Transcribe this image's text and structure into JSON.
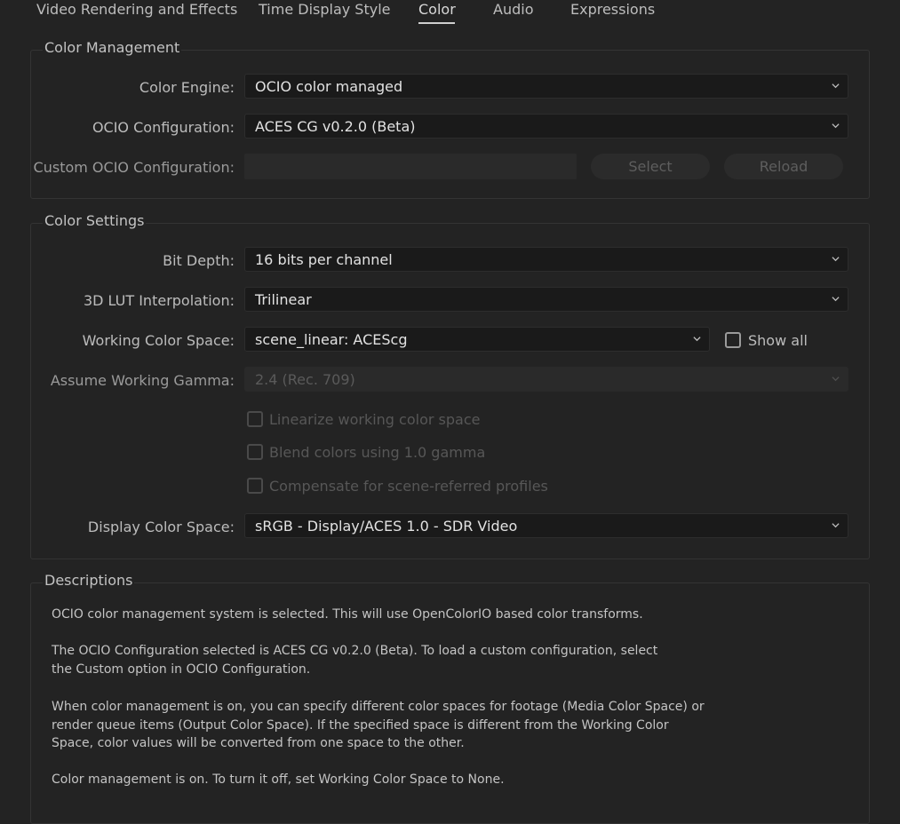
{
  "tabs": [
    {
      "label": "Video Rendering and Effects",
      "active": false
    },
    {
      "label": "Time Display Style",
      "active": false
    },
    {
      "label": "Color",
      "active": true
    },
    {
      "label": "Audio",
      "active": false
    },
    {
      "label": "Expressions",
      "active": false
    }
  ],
  "color_management": {
    "title": "Color Management",
    "color_engine": {
      "label": "Color Engine:",
      "value": "OCIO color managed"
    },
    "ocio_configuration": {
      "label": "OCIO Configuration:",
      "value": "ACES CG v0.2.0 (Beta)"
    },
    "custom_ocio": {
      "label": "Custom OCIO Configuration:",
      "value": "",
      "enabled": false
    },
    "select_button": "Select",
    "reload_button": "Reload"
  },
  "color_settings": {
    "title": "Color Settings",
    "bit_depth": {
      "label": "Bit Depth:",
      "value": "16 bits per channel"
    },
    "lut_interpolation": {
      "label": "3D LUT Interpolation:",
      "value": "Trilinear"
    },
    "working_color_space": {
      "label": "Working Color Space:",
      "value": "scene_linear: ACEScg"
    },
    "show_all": {
      "label": "Show all",
      "checked": false
    },
    "assume_gamma": {
      "label": "Assume Working Gamma:",
      "value": "2.4 (Rec. 709)",
      "enabled": false
    },
    "linearize": {
      "label": "Linearize working color space",
      "checked": false,
      "enabled": false
    },
    "blend": {
      "label": "Blend colors using 1.0 gamma",
      "checked": false,
      "enabled": false
    },
    "compensate": {
      "label": "Compensate for scene-referred profiles",
      "checked": false,
      "enabled": false
    },
    "display_color_space": {
      "label": "Display Color Space:",
      "value": "sRGB - Display/ACES 1.0 - SDR Video"
    }
  },
  "descriptions": {
    "title": "Descriptions",
    "paragraphs": [
      "OCIO color management system is selected. This will use OpenColorIO based color transforms.",
      "The OCIO Configuration selected is ACES CG v0.2.0 (Beta). To load a custom configuration, select the Custom option in OCIO Configuration.",
      "When color management is on, you can specify different color spaces for footage (Media Color Space) or render queue items (Output Color Space). If the specified space is different from the Working Color Space, color values will be converted from one space to the other.",
      "Color management is on. To turn it off, set Working Color Space to None."
    ]
  },
  "colors": {
    "background": "#232323",
    "field": "#1a1a1a",
    "text": "#c8c8c8",
    "disabled_text": "#5a5a5a"
  }
}
